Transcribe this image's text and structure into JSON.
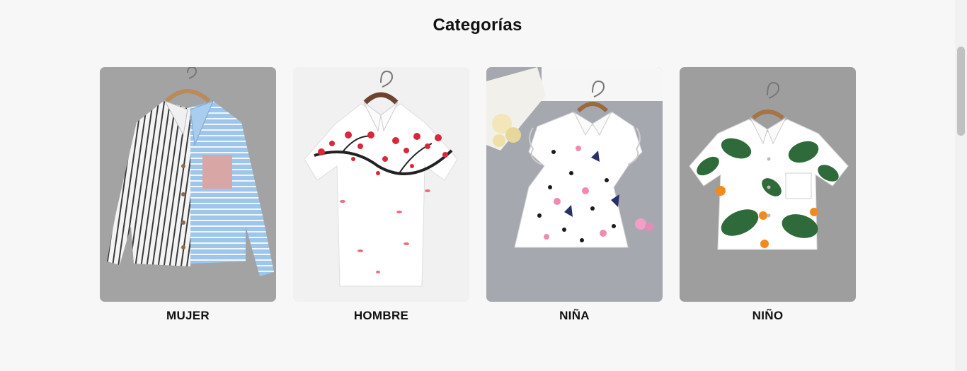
{
  "section": {
    "title": "Categorías"
  },
  "categories": [
    {
      "label": "MUJER",
      "image": "womens-striped-shirt"
    },
    {
      "label": "HOMBRE",
      "image": "mens-floral-shirt"
    },
    {
      "label": "NIÑA",
      "image": "girls-printed-blouse"
    },
    {
      "label": "NIÑO",
      "image": "boys-leaf-print-shirt"
    }
  ],
  "colors": {
    "page_background": "#f7f7f7",
    "text": "#111111"
  }
}
